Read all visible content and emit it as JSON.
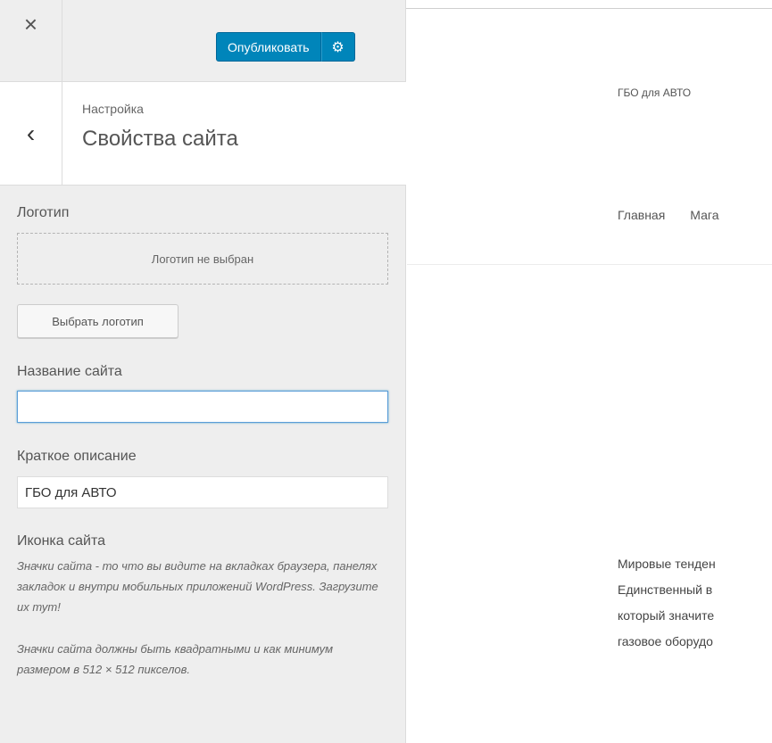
{
  "header": {
    "close_icon": "×",
    "publish_label": "Опубликовать",
    "gear_icon": "⚙"
  },
  "section": {
    "back_icon": "‹",
    "breadcrumb": "Настройка",
    "title": "Свойства сайта"
  },
  "logo": {
    "label": "Логотип",
    "placeholder": "Логотип не выбран",
    "choose_button": "Выбрать логотип"
  },
  "site_title": {
    "label": "Название сайта",
    "value": ""
  },
  "tagline": {
    "label": "Краткое описание",
    "value": "ГБО для АВТО"
  },
  "site_icon": {
    "label": "Иконка сайта",
    "desc1": "Значки сайта - то что вы видите на вкладках браузера, панелях закладок и внутри мобильных приложений WordPress. Загрузите их тут!",
    "desc2": "Значки сайта должны быть квадратными и как минимум размером в 512 × 512 пикселов."
  },
  "preview": {
    "tagline": "ГБО для АВТО",
    "nav": [
      "Главная",
      "Мага"
    ],
    "body_lines": [
      "Мировые тенден",
      "Единственный в",
      "который значите",
      "газовое оборудо"
    ]
  },
  "colors": {
    "accent": "#0085ba",
    "sidebar_bg": "#eeeeee"
  }
}
